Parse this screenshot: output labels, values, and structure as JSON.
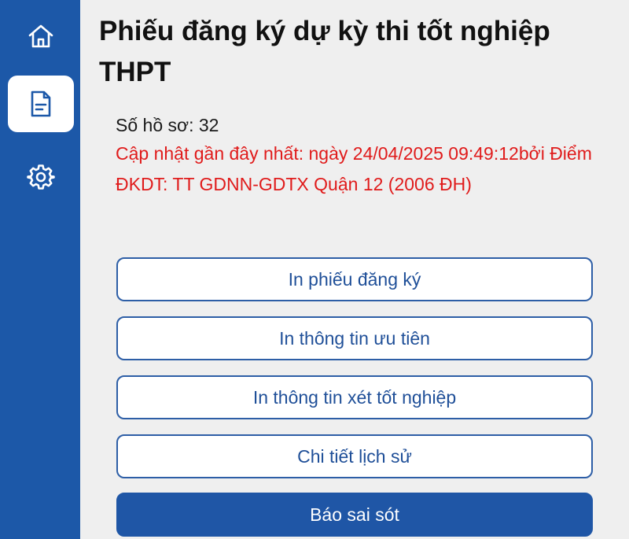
{
  "sidebar": {
    "items": [
      {
        "icon": "home-icon",
        "active": false
      },
      {
        "icon": "document-icon",
        "active": true
      },
      {
        "icon": "gear-icon",
        "active": false
      }
    ]
  },
  "page": {
    "title": "Phiếu đăng ký dự kỳ thi tốt nghiệp THPT",
    "record_number": "Số hồ sơ: 32",
    "last_update": "Cập nhật gần đây nhất: ngày 24/04/2025 09:49:12bởi Điểm ĐKDT: TT GDNN-GDTX Quận 12 (2006 ĐH)"
  },
  "actions": {
    "print_registration": "In phiếu đăng ký",
    "print_priority": "In thông tin ưu tiên",
    "print_graduation": "In thông tin xét tốt nghiệp",
    "history_detail": "Chi tiết lịch sử",
    "report_error": "Báo sai sót"
  },
  "colors": {
    "sidebar": "#1c58a8",
    "accent": "#1f56a6",
    "warning_text": "#e01b1b",
    "background": "#efefef"
  }
}
